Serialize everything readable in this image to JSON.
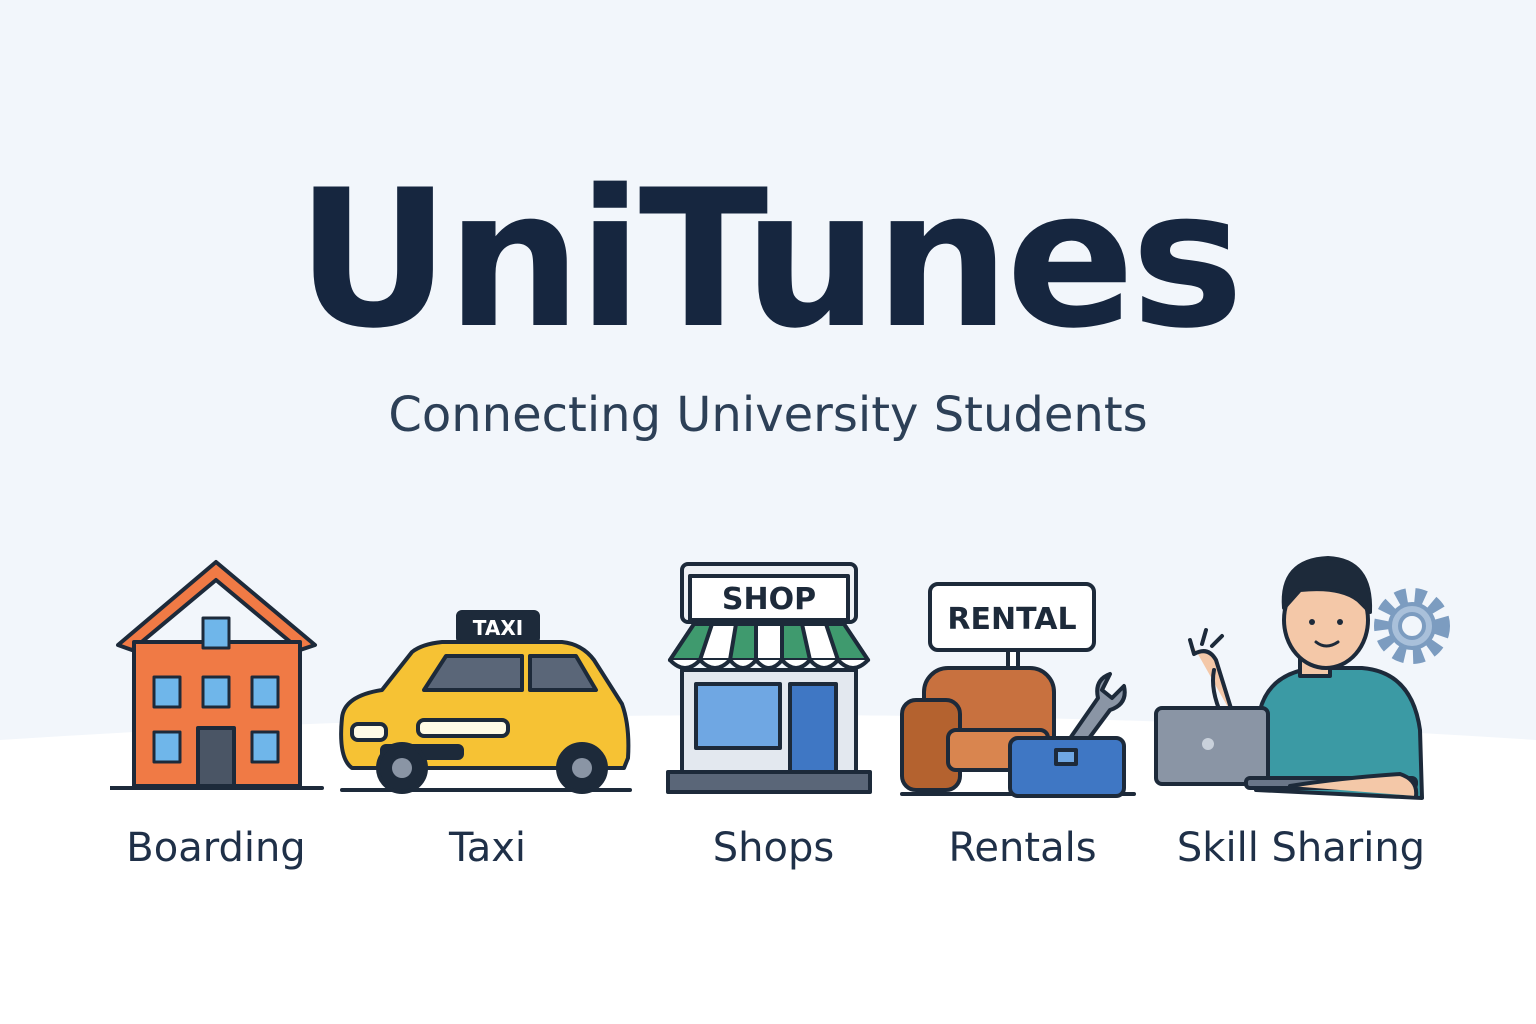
{
  "title": "UniTunes",
  "subtitle": "Connecting University Students",
  "categories": [
    {
      "label": "Boarding",
      "icon": "house-icon"
    },
    {
      "label": "Taxi",
      "icon": "taxi-icon",
      "sign": "TAXI"
    },
    {
      "label": "Shops",
      "icon": "shop-icon",
      "sign": "SHOP"
    },
    {
      "label": "Rentals",
      "icon": "rental-icon",
      "sign": "RENTAL"
    },
    {
      "label": "Skill Sharing",
      "icon": "skill-sharing-icon"
    }
  ],
  "colors": {
    "background": "#f2f6fb",
    "title": "#16263f",
    "house": "#f07a45",
    "taxi": "#f6c234",
    "awning": "#3f9a6e",
    "sofa": "#c8713f",
    "toolbox": "#3f77c4",
    "shirt": "#3b9aa4"
  }
}
